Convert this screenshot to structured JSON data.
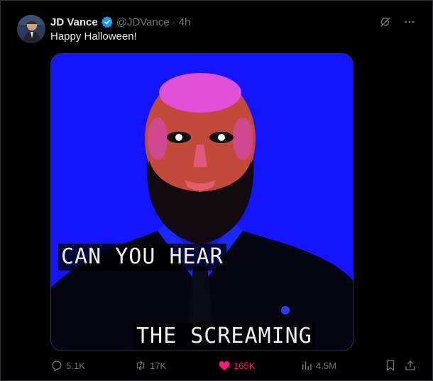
{
  "tweet": {
    "author_name": "JD Vance",
    "handle": "@JDVance",
    "separator": "·",
    "time": "4h",
    "text": "Happy Halloween!",
    "verified": true
  },
  "media": {
    "caption_line1": "CAN YOU HEAR",
    "caption_line2": "THE SCREAMING"
  },
  "actions": {
    "replies": "5.1K",
    "reposts": "17K",
    "likes": "165K",
    "views": "4.5M"
  },
  "colors": {
    "background": "#000000",
    "text": "#e7e9ea",
    "muted": "#71767b",
    "verified": "#1d9bf0",
    "like": "#f91880",
    "image_blue": "#1414ff",
    "image_magenta": "#e040e0"
  },
  "icons": [
    "verified-badge-icon",
    "grok-icon",
    "more-icon",
    "reply-icon",
    "repost-icon",
    "heart-icon",
    "views-icon",
    "bookmark-icon",
    "share-icon"
  ]
}
